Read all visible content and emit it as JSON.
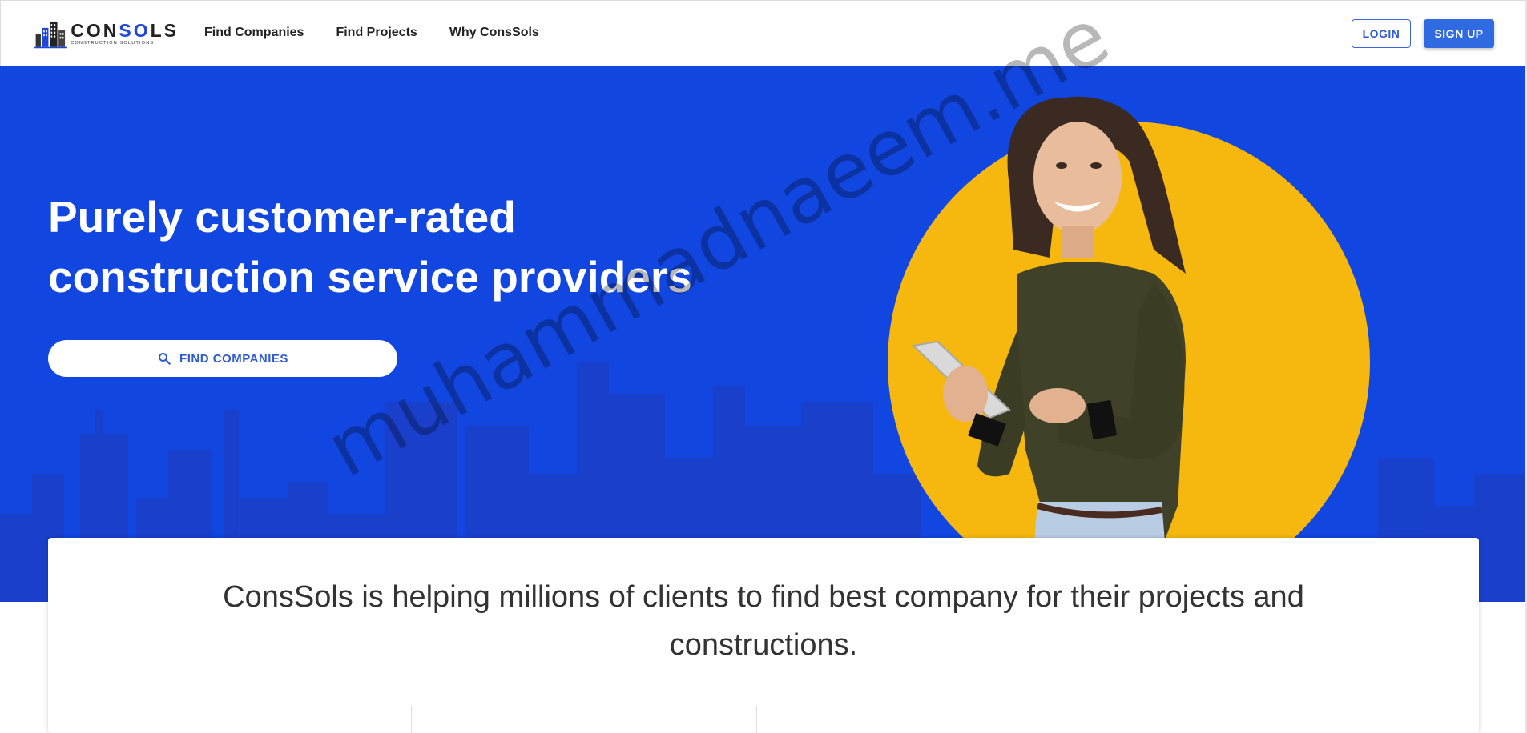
{
  "header": {
    "logo": {
      "brand_left": "CON",
      "brand_accent": "S",
      "brand_o": "O",
      "brand_right": "LS",
      "tagline": "CONSTRUCTION SOLUTIONS"
    },
    "nav": [
      "Find Companies",
      "Find Projects",
      "Why ConsSols"
    ],
    "login_label": "LOGIN",
    "signup_label": "SIGN UP"
  },
  "hero": {
    "title_line1": "Purely customer-rated",
    "title_line2": "construction service providers",
    "search_button_label": "FIND COMPANIES",
    "search_icon": "search-icon",
    "image": "woman-with-tablet"
  },
  "info_card": {
    "text": "ConsSols is helping millions of clients to find best company for their projects and constructions."
  },
  "watermark": "muhammadnaeem.me",
  "colors": {
    "hero_bg": "#1146e0",
    "accent_circle": "#f6b80e",
    "primary_button": "#2f6ae0",
    "brand_blue": "#1f47d6"
  }
}
